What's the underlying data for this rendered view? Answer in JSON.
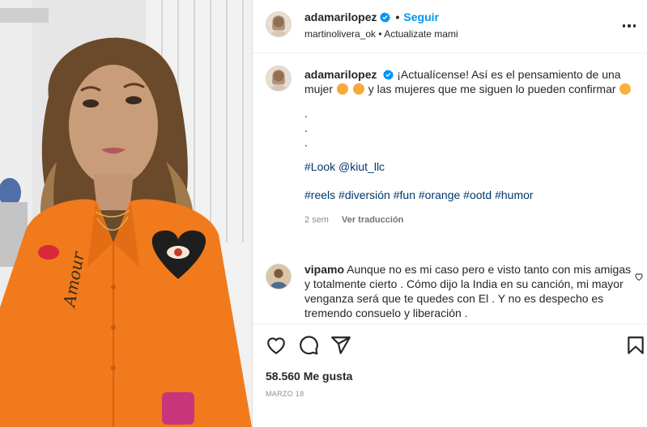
{
  "post": {
    "author": "adamarilopez",
    "follow_label": "Seguir",
    "separator": "•",
    "audio": "martinolivera_ok • Actualizate mami",
    "caption": {
      "line1_text": "¡Actualícense! Así es el pensamiento de una mujer",
      "line1_tail": "y las mujeres que me siguen lo pueden confirmar",
      "dots": [
        ".",
        ".",
        "."
      ],
      "look_tag": "#Look",
      "look_mention": "@kiut_llc",
      "hashtags": [
        "#reels",
        "#diversión",
        "#fun",
        "#orange",
        "#ootd",
        "#humor"
      ],
      "age": "2 sem",
      "translate_label": "Ver traducción"
    },
    "comment": {
      "author": "vipamo",
      "text": "Aunque no es mi caso pero e visto tanto con mis amigas y totalmente cierto . Cómo dijo la India en su canción, mi mayor venganza será que te quedes con El . Y no es despecho es tremendo consuelo y liberación ."
    },
    "likes": "58.560 Me gusta",
    "date": "MARZO 18"
  },
  "icons": {
    "more": "more-options-icon",
    "verified": "verified-badge-icon",
    "like": "heart-icon",
    "comment": "comment-icon",
    "share": "share-icon",
    "save": "bookmark-icon"
  },
  "colors": {
    "accent": "#0095f6",
    "verified": "#0095f6",
    "link": "#00376b",
    "shirt": "#f07a1c"
  }
}
